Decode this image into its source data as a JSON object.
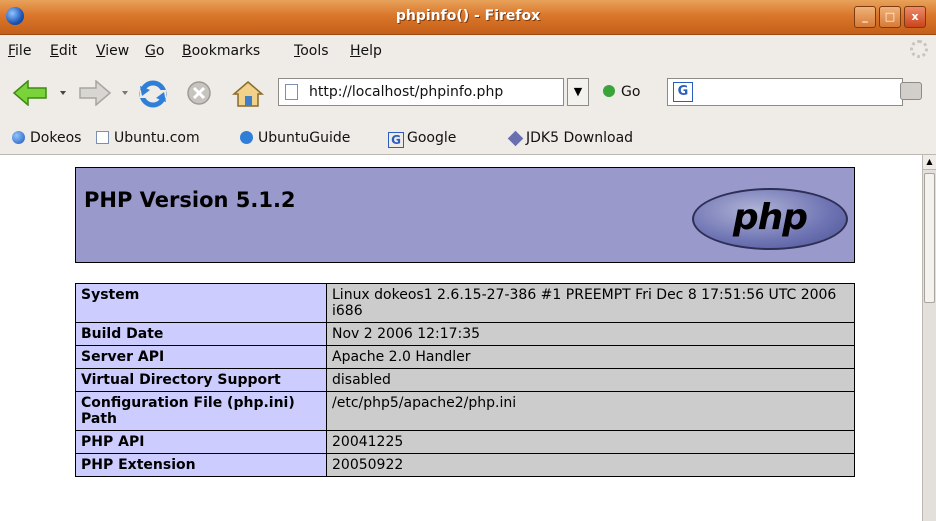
{
  "window": {
    "title": "phpinfo() - Firefox",
    "buttons": {
      "minimize": "_",
      "maximize": "□",
      "close": "x"
    }
  },
  "menu": [
    {
      "key": "F",
      "rest": "ile"
    },
    {
      "key": "E",
      "rest": "dit"
    },
    {
      "key": "V",
      "rest": "iew"
    },
    {
      "key": "G",
      "rest": "o"
    },
    {
      "key": "B",
      "rest": "ookmarks"
    },
    {
      "key": "T",
      "rest": "ools"
    },
    {
      "key": "H",
      "rest": "elp"
    }
  ],
  "nav": {
    "url": "http://localhost/phpinfo.php",
    "go_label": "Go",
    "search_value": "",
    "search_engine_letter": "G"
  },
  "bookmarks": [
    {
      "label": "Dokeos",
      "icon": "globe-icon"
    },
    {
      "label": "Ubuntu.com",
      "icon": "page-icon"
    },
    {
      "label": "UbuntuGuide",
      "icon": "info-icon"
    },
    {
      "label": "Google",
      "icon": "google-icon"
    },
    {
      "label": "JDK5 Download",
      "icon": "java-icon"
    }
  ],
  "page": {
    "heading": "PHP Version 5.1.2",
    "logo_text": "php",
    "rows": [
      {
        "label": "System",
        "value": "Linux dokeos1 2.6.15-27-386 #1 PREEMPT Fri Dec 8 17:51:56 UTC 2006 i686"
      },
      {
        "label": "Build Date",
        "value": "Nov 2 2006 12:17:35"
      },
      {
        "label": "Server API",
        "value": "Apache 2.0 Handler"
      },
      {
        "label": "Virtual Directory Support",
        "value": "disabled"
      },
      {
        "label": "Configuration File (php.ini) Path",
        "value": "/etc/php5/apache2/php.ini"
      },
      {
        "label": "PHP API",
        "value": "20041225"
      },
      {
        "label": "PHP Extension",
        "value": "20050922"
      }
    ]
  }
}
